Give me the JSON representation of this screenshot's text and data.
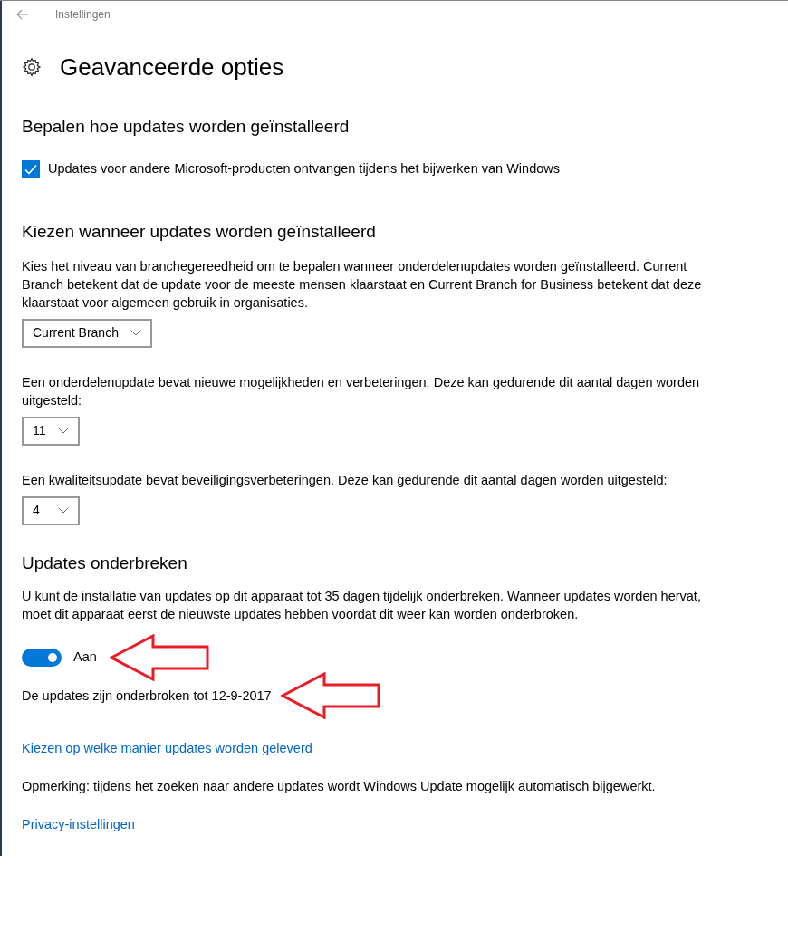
{
  "window": {
    "title": "Instellingen"
  },
  "page_title": "Geavanceerde opties",
  "install_section": {
    "heading": "Bepalen hoe updates worden geïnstalleerd",
    "checkbox": {
      "label": "Updates voor andere Microsoft-producten ontvangen tijdens het bijwerken van Windows",
      "checked": true
    }
  },
  "when_section": {
    "heading": "Kiezen wanneer updates worden geïnstalleerd",
    "settings": [
      {
        "description": "Kies het niveau van branchegereedheid om te bepalen wanneer onderdelenupdates worden geïnstalleerd. Current Branch betekent dat de update voor de meeste mensen klaarstaat en Current Branch for Business betekent dat deze klaarstaat voor algemeen gebruik in organisaties.",
        "value": "Current Branch"
      },
      {
        "description": "Een onderdelenupdate bevat nieuwe mogelijkheden en verbeteringen. Deze kan gedurende dit aantal dagen worden uitgesteld:",
        "value": "11"
      },
      {
        "description": "Een kwaliteitsupdate bevat beveiligingsverbeteringen. Deze kan gedurende dit aantal dagen worden uitgesteld:",
        "value": "4"
      }
    ]
  },
  "pause_section": {
    "heading": "Updates onderbreken",
    "description": "U kunt de installatie van updates op dit apparaat tot 35 dagen tijdelijk onderbreken. Wanneer updates worden hervat, moet dit apparaat eerst de nieuwste updates hebben voordat dit weer kan worden onderbroken.",
    "toggle": {
      "label": "Aan",
      "on": true
    },
    "status": "De updates zijn onderbroken tot 12-9-2017"
  },
  "links": [
    {
      "kind": "link",
      "text": "Kiezen op welke manier updates worden geleverd"
    },
    {
      "kind": "note",
      "text": "Opmerking: tijdens het zoeken naar andere updates wordt Windows Update mogelijk automatisch bijgewerkt."
    },
    {
      "kind": "link",
      "text": "Privacy-instellingen"
    }
  ]
}
